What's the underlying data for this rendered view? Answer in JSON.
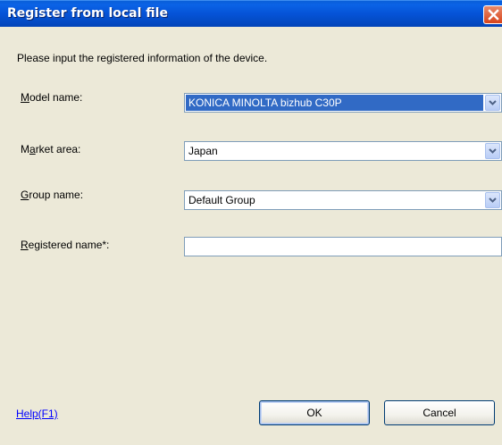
{
  "window": {
    "title": "Register from local file",
    "close_icon": "close-icon"
  },
  "instruction": "Please input the registered information of the device.",
  "fields": {
    "model": {
      "label_mnemonic": "M",
      "label_rest": "odel name:",
      "value": "KONICA MINOLTA bizhub C30P"
    },
    "market": {
      "label_start": "M",
      "label_mnemonic": "a",
      "label_rest": "rket area:",
      "value": "Japan"
    },
    "group": {
      "label_mnemonic": "G",
      "label_rest": "roup name:",
      "value": "Default Group"
    },
    "registered": {
      "label_mnemonic": "R",
      "label_rest": "egistered name*:",
      "value": ""
    }
  },
  "buttons": {
    "help": "Help(F1)",
    "ok": "OK",
    "cancel": "Cancel"
  },
  "colors": {
    "titlebar": "#0553d7",
    "selection": "#316ac5",
    "close": "#d8441c"
  }
}
